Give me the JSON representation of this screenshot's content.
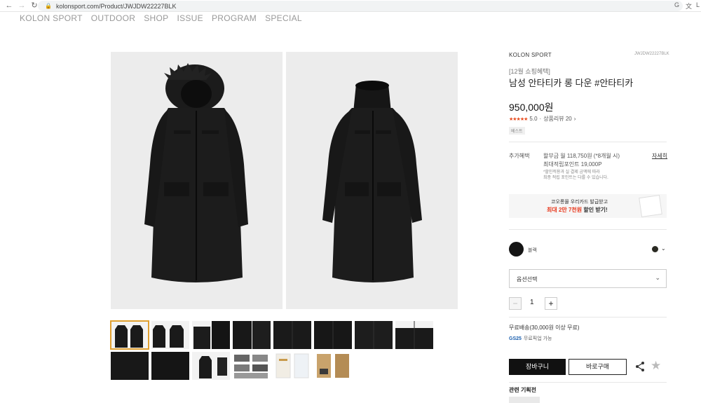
{
  "browser": {
    "url": "kolonsport.com/Product/JWJDW22227BLK"
  },
  "nav": {
    "items": [
      "KOLON SPORT",
      "OUTDOOR",
      "SHOP",
      "ISSUE",
      "PROGRAM",
      "SPECIAL"
    ]
  },
  "product": {
    "brand": "KOLON SPORT",
    "code": "JWJDW22227BLK",
    "promo": "[12월 쇼핑혜택]",
    "title": "남성 안타티카 롱 다운 #안타티카",
    "price": "950,000원",
    "rating_stars": "★★★★★",
    "rating_score": "5.0",
    "review_label": "상품리뷰 20",
    "badge": "베스트"
  },
  "benefits": {
    "label": "추가혜택",
    "installment": "할부금 월 118,750원 (*8개월 시)",
    "points": "최대적립포인트 19,000P",
    "note_line1": "*할인적용과 실 결제 금액에 따라",
    "note_line2": "최종 적립 포인트는 다를 수 있습니다.",
    "detail_link": "자세히"
  },
  "coupon": {
    "line1": "코오롱몰 우리카드 발급받고",
    "line2_red": "최대 2만 7천원",
    "line2_rest": " 할인 받기!"
  },
  "color": {
    "name": "블랙",
    "swatch": "#151515"
  },
  "option_select": {
    "label": "옵션선택"
  },
  "quantity": {
    "minus": "−",
    "value": "1",
    "plus": "+"
  },
  "shipping": {
    "text": "무료배송(30,000원 이상 무료)",
    "gs_logo": "GS25",
    "gs_text": "무료픽업 가능"
  },
  "actions": {
    "cart": "장바구니",
    "buy": "바로구매"
  },
  "related": {
    "title": "관련 기획전"
  },
  "colors": {
    "rating_star": "#e84a1c",
    "coupon_red": "#e8381c",
    "thumb_active": "#e0a030",
    "cart_button": "#111111"
  }
}
